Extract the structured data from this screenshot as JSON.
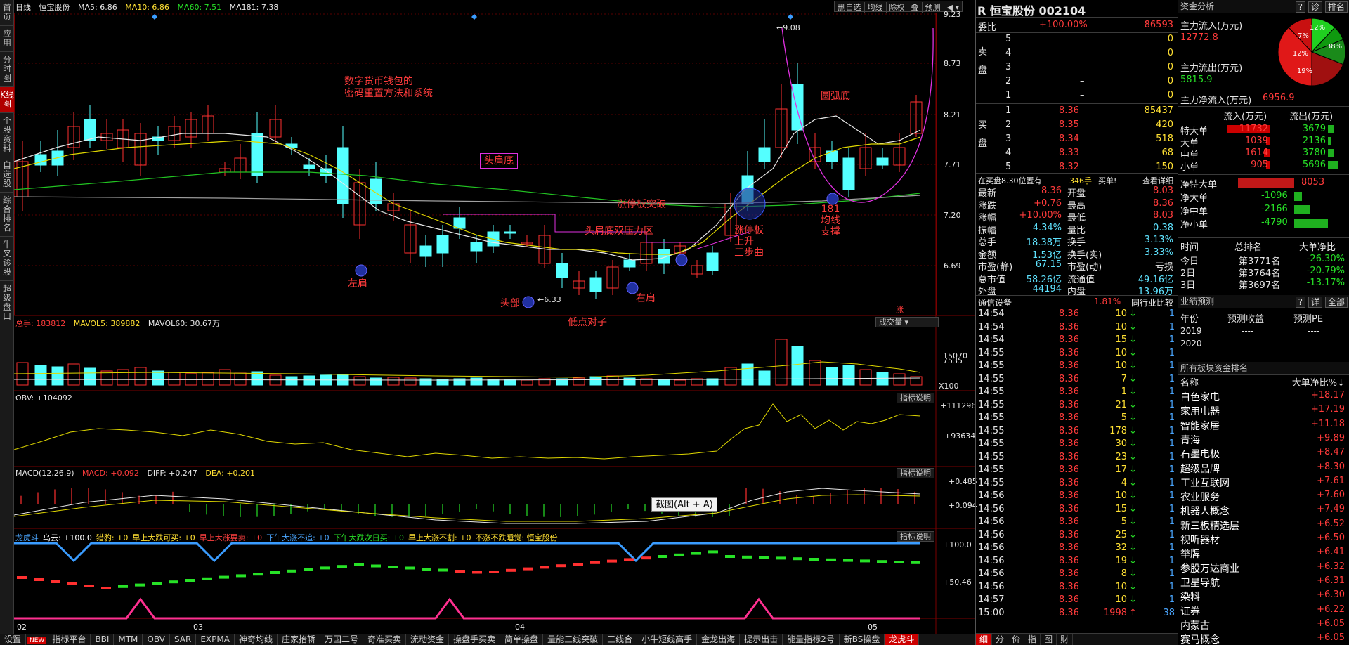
{
  "sidebar": {
    "tabs": [
      "首页",
      "应用",
      "分时图",
      "K线图",
      "个股资料",
      "自选股",
      "综合排名",
      "牛叉诊股",
      "超级盘口"
    ],
    "active": 3
  },
  "header": {
    "period": "日线",
    "stock_name": "恒宝股份",
    "ma5": "MA5: 6.86",
    "ma10": "MA10: 6.86",
    "ma60": "MA60: 7.51",
    "ma181": "MA181: 7.38"
  },
  "toolstrip": [
    "删自选",
    "均线",
    "除权",
    "叠",
    "预测"
  ],
  "price_axis": [
    "9.23",
    "8.73",
    "8.21",
    "7.71",
    "7.20",
    "6.69"
  ],
  "price_marks": {
    "high": "9.08",
    "low": "6.33"
  },
  "annotations": {
    "left_shoulder": "左肩",
    "head": "头部",
    "right_shoulder": "右肩",
    "low_pair": "低点对子",
    "hs_bottom": "头肩底",
    "hs_pressure": "头肩底双压力区",
    "limit_up_break": "涨停板突破",
    "limit_up_rise": "涨停板\n上升\n三步曲",
    "arc_bottom": "圆弧底",
    "ma_support": "181\n均线\n支撑",
    "crypto_text": "数字货币钱包的\n密码重置方法和系统",
    "zhang": "涨"
  },
  "volume": {
    "header_total": "总手: 183812",
    "mavol5": "MAVOL5: 389882",
    "mavol60": "MAVOL60: 30.67万",
    "selector": "成交量",
    "axis": [
      "15070",
      "7535",
      "X100"
    ]
  },
  "obv": {
    "label": "OBV: +104092",
    "btn": "指标说明",
    "axis": [
      "+111296",
      "+93634"
    ]
  },
  "macd": {
    "label": "MACD(12,26,9)",
    "macd": "MACD: +0.092",
    "diff": "DIFF: +0.247",
    "dea": "DEA: +0.201",
    "btn": "指标说明",
    "axis": [
      "+0.485",
      "+0.094"
    ]
  },
  "tooltip": "截图(Alt + A)",
  "lhd": {
    "items": [
      "龙虎斗",
      "乌云: +100.0",
      "猎豹: +0",
      "早上大跌可买: +0",
      "早上大涨要卖: +0",
      "下午大涨不追: +0",
      "下午大跌次日买: +0",
      "早上大涨不割: +0",
      "不涨不跌睡觉: 恒宝股份"
    ],
    "btn": "指标说明",
    "axis": [
      "+100.0",
      "+50.46"
    ]
  },
  "date_axis": [
    "02",
    "03",
    "04",
    "05"
  ],
  "bottom_tabs": [
    "设置",
    "NEW",
    "指标平台",
    "BBI",
    "MTM",
    "OBV",
    "SAR",
    "EXPMA",
    "神奇均线",
    "庄家抬轿",
    "万国二号",
    "奇准买卖",
    "流动资金",
    "操盘手买卖",
    "简单操盘",
    "量能三线突破",
    "三线合",
    "小牛短线高手",
    "金龙出海",
    "提示出击",
    "能量指标2号",
    "新BS操盘",
    "龙虎斗"
  ],
  "quote": {
    "marker": "R",
    "title": "恒宝股份",
    "code": "002104",
    "webi_label": "委比",
    "webi": "+100.00%",
    "webi_val": "86593",
    "sell_side": "卖盘",
    "buy_side": "买盘",
    "sells": [
      {
        "n": "5",
        "p": "–",
        "v": "0"
      },
      {
        "n": "4",
        "p": "–",
        "v": "0"
      },
      {
        "n": "3",
        "p": "–",
        "v": "0"
      },
      {
        "n": "2",
        "p": "–",
        "v": "0"
      },
      {
        "n": "1",
        "p": "–",
        "v": "0"
      }
    ],
    "buys": [
      {
        "n": "1",
        "p": "8.36",
        "v": "85437"
      },
      {
        "n": "2",
        "p": "8.35",
        "v": "420"
      },
      {
        "n": "3",
        "p": "8.34",
        "v": "518"
      },
      {
        "n": "4",
        "p": "8.33",
        "v": "68"
      },
      {
        "n": "5",
        "p": "8.32",
        "v": "150"
      }
    ],
    "buy_line": "在买盘8.30位置有",
    "buy_line_v": "346手",
    "buy_line_x": "买单!",
    "buy_line_more": "查看详细",
    "stats": [
      [
        "最新",
        "8.36",
        "开盘",
        "8.03"
      ],
      [
        "涨跌",
        "+0.76",
        "最高",
        "8.36"
      ],
      [
        "涨幅",
        "+10.00%",
        "最低",
        "8.03"
      ],
      [
        "振幅",
        "4.34%",
        "量比",
        "0.38"
      ],
      [
        "总手",
        "18.38万",
        "换手",
        "3.13%"
      ],
      [
        "金额",
        "1.53亿",
        "换手(实)",
        "3.33%"
      ],
      [
        "市盈(静)",
        "67.15",
        "市盈(动)",
        "亏损"
      ],
      [
        "总市值",
        "58.26亿",
        "流通值",
        "49.16亿"
      ],
      [
        "外盘",
        "44194",
        "内盘",
        "13.96万"
      ]
    ],
    "sector_label": "通信设备",
    "sector_pct": "1.81%",
    "peer_btn": "同行业比较",
    "ticks": [
      [
        "14:54",
        "8.36",
        "10"
      ],
      [
        "14:54",
        "8.36",
        "10"
      ],
      [
        "14:54",
        "8.36",
        "15"
      ],
      [
        "14:55",
        "8.36",
        "10"
      ],
      [
        "14:55",
        "8.36",
        "10"
      ],
      [
        "14:55",
        "8.36",
        "7"
      ],
      [
        "14:55",
        "8.36",
        "1"
      ],
      [
        "14:55",
        "8.36",
        "21"
      ],
      [
        "14:55",
        "8.36",
        "5"
      ],
      [
        "14:55",
        "8.36",
        "178"
      ],
      [
        "14:55",
        "8.36",
        "30"
      ],
      [
        "14:55",
        "8.36",
        "23"
      ],
      [
        "14:55",
        "8.36",
        "17"
      ],
      [
        "14:55",
        "8.36",
        "4"
      ],
      [
        "14:56",
        "8.36",
        "10"
      ],
      [
        "14:56",
        "8.36",
        "15"
      ],
      [
        "14:56",
        "8.36",
        "5"
      ],
      [
        "14:56",
        "8.36",
        "25"
      ],
      [
        "14:56",
        "8.36",
        "32"
      ],
      [
        "14:56",
        "8.36",
        "19"
      ],
      [
        "14:56",
        "8.36",
        "8"
      ],
      [
        "14:56",
        "8.36",
        "10"
      ],
      [
        "14:57",
        "8.36",
        "10"
      ],
      [
        "15:00",
        "8.36",
        "1998"
      ]
    ],
    "tick_side_nums": [
      "1",
      "1",
      "1",
      "1",
      "1",
      "1",
      "1",
      "1",
      "1",
      "1",
      "1",
      "1",
      "1",
      "1",
      "1",
      "1",
      "1",
      "1",
      "1",
      "1",
      "1",
      "1",
      "1",
      "38"
    ],
    "tick_tabs": [
      "细",
      "分",
      "价",
      "指",
      "图",
      "财"
    ]
  },
  "fund": {
    "title": "资金分析",
    "btns": [
      "?",
      "诊",
      "排名"
    ],
    "main_in_label": "主力流入(万元)",
    "main_in": "12772.8",
    "main_out_label": "主力流出(万元)",
    "main_out": "5815.9",
    "main_net_label": "主力净流入(万元)",
    "main_net": "6956.9",
    "pie_labels": [
      "12%",
      "7%",
      "12%",
      "19%",
      "38%"
    ],
    "flow_head": [
      "流入(万元)",
      "流出(万元)"
    ],
    "flows": [
      {
        "label": "特大单",
        "in": "11732",
        "out": "3679",
        "in_pct": 1.0,
        "out_pct": 0.31
      },
      {
        "label": "大单",
        "in": "1039",
        "out": "2136",
        "in_pct": 0.09,
        "out_pct": 0.18
      },
      {
        "label": "中单",
        "in": "1614",
        "out": "3780",
        "in_pct": 0.14,
        "out_pct": 0.32
      },
      {
        "label": "小单",
        "in": "905",
        "out": "5696",
        "in_pct": 0.08,
        "out_pct": 0.49
      }
    ],
    "nets": [
      {
        "label": "净特大单",
        "val": "8053",
        "pct": 1.0,
        "pos": true
      },
      {
        "label": "净大单",
        "val": "-1096",
        "pct": 0.14,
        "pos": false
      },
      {
        "label": "净中单",
        "val": "-2166",
        "pct": 0.27,
        "pos": false
      },
      {
        "label": "净小单",
        "val": "-4790",
        "pct": 0.6,
        "pos": false
      }
    ],
    "rank_head": [
      "时间",
      "总排名",
      "大单净比"
    ],
    "ranks": [
      [
        "今日",
        "第3771名",
        "-26.30%"
      ],
      [
        "2日",
        "第3764名",
        "-20.79%"
      ],
      [
        "3日",
        "第3697名",
        "-13.17%"
      ]
    ],
    "forecast_title": "业绩预测",
    "forecast_btns": [
      "?",
      "详",
      "全部"
    ],
    "forecast_head": [
      "年份",
      "预测收益",
      "预测PE"
    ],
    "forecasts": [
      [
        "2019",
        "----",
        "----"
      ],
      [
        "2020",
        "----",
        "----"
      ]
    ],
    "sector_title": "所有板块资金排名",
    "sector_head": [
      "名称",
      "大单净比%"
    ],
    "sectors": [
      [
        "白色家电",
        "+18.17"
      ],
      [
        "家用电器",
        "+17.19"
      ],
      [
        "智能家居",
        "+11.18"
      ],
      [
        "青海",
        "+9.89"
      ],
      [
        "石墨电极",
        "+8.47"
      ],
      [
        "超级品牌",
        "+8.30"
      ],
      [
        "工业互联网",
        "+7.61"
      ],
      [
        "农业服务",
        "+7.60"
      ],
      [
        "机器人概念",
        "+7.49"
      ],
      [
        "新三板精选层",
        "+6.52"
      ],
      [
        "视听器材",
        "+6.50"
      ],
      [
        "举牌",
        "+6.41"
      ],
      [
        "参股万达商业",
        "+6.32"
      ],
      [
        "卫星导航",
        "+6.31"
      ],
      [
        "染料",
        "+6.30"
      ],
      [
        "证券",
        "+6.22"
      ],
      [
        "内蒙古",
        "+6.05"
      ],
      [
        "赛马概念",
        "+6.05"
      ]
    ]
  },
  "colors": {
    "up": "#ff3030",
    "down": "#54ffff",
    "ma5": "#e8e8e8",
    "ma10": "#e0d800",
    "ma60": "#22c322",
    "ma181": "#a0a0a0",
    "magenta": "#e030e0",
    "accent": "#b00000"
  }
}
